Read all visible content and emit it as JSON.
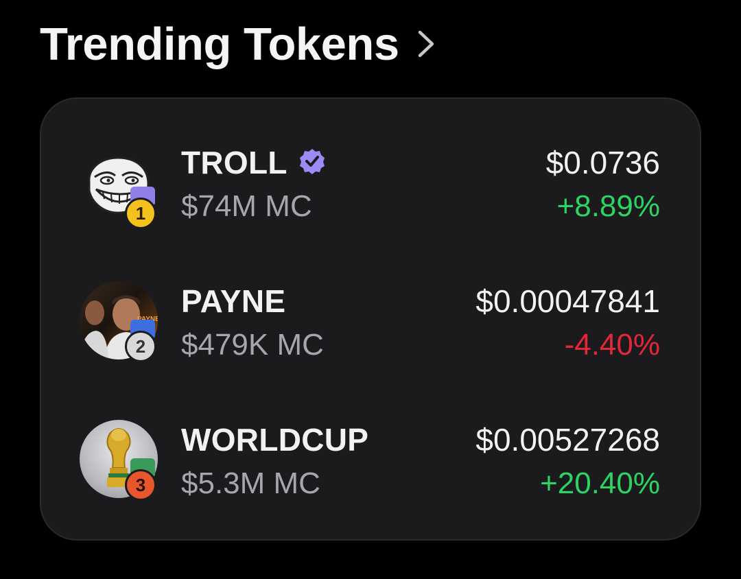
{
  "header": {
    "title": "Trending Tokens",
    "chevron_icon": "chevron-right-icon"
  },
  "colors": {
    "background": "#000000",
    "card": "#1b1b1d",
    "positive": "#2bd563",
    "negative": "#e5263a",
    "verified": "#9b8cf5",
    "secondary_text": "#a6a6ab"
  },
  "tokens": [
    {
      "rank": "1",
      "name": "TROLL",
      "verified": true,
      "market_cap": "$74M MC",
      "price": "$0.0736",
      "change": "+8.89%",
      "direction": "up",
      "medal": "gold-medal-icon",
      "avatar": "trollface-avatar"
    },
    {
      "rank": "2",
      "name": "PAYNE",
      "verified": false,
      "market_cap": "$479K MC",
      "price": "$0.00047841",
      "change": "-4.40%",
      "direction": "down",
      "medal": "silver-medal-icon",
      "avatar": "payne-avatar"
    },
    {
      "rank": "3",
      "name": "WORLDCUP",
      "verified": false,
      "market_cap": "$5.3M MC",
      "price": "$0.00527268",
      "change": "+20.40%",
      "direction": "up",
      "medal": "bronze-medal-icon",
      "avatar": "world-cup-trophy-avatar"
    }
  ]
}
